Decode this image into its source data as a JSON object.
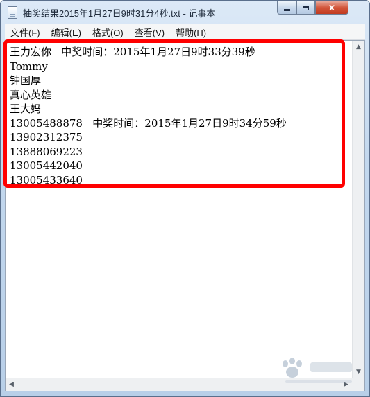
{
  "window": {
    "title": "抽奖结果2015年1月27日9时31分4秒.txt - 记事本",
    "close_glyph": "x"
  },
  "menu": [
    {
      "label": "文件(F)"
    },
    {
      "label": "编辑(E)"
    },
    {
      "label": "格式(O)"
    },
    {
      "label": "查看(V)"
    },
    {
      "label": "帮助(H)"
    }
  ],
  "document": {
    "lines": [
      "王力宏你   中奖时间：2015年1月27日9时33分39秒",
      "Tommy",
      "钟国厚",
      "真心英雄",
      "王大妈",
      "13005488878   中奖时间：2015年1月27日9时34分59秒",
      "13902312375",
      "13888069223",
      "13005442040",
      "13005433640"
    ]
  },
  "colors": {
    "annotation_highlight": "#ff0000",
    "close_button": "#c9452a"
  },
  "icons": {
    "app": "notepad-icon",
    "scroll_up": "▲",
    "scroll_down": "▼",
    "scroll_left": "◀",
    "scroll_right": "▶"
  }
}
